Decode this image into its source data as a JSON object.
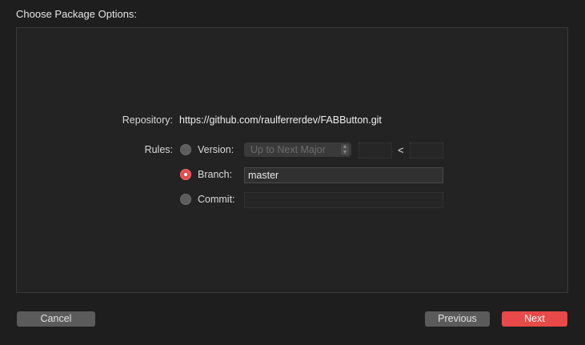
{
  "dialog": {
    "title": "Choose Package Options:"
  },
  "repository": {
    "label": "Repository:",
    "url": "https://github.com/raulferrerdev/FABButton.git"
  },
  "rules": {
    "label": "Rules:",
    "version": {
      "label": "Version:",
      "selected": false,
      "popup_value": "Up to Next Major",
      "lower_value": "",
      "less_than": "<",
      "upper_value": ""
    },
    "branch": {
      "label": "Branch:",
      "selected": true,
      "value": "master"
    },
    "commit": {
      "label": "Commit:",
      "selected": false,
      "value": ""
    }
  },
  "buttons": {
    "cancel": "Cancel",
    "previous": "Previous",
    "next": "Next"
  },
  "colors": {
    "accent": "#e74a48",
    "background": "#1e1e1e",
    "panel": "#232323"
  }
}
